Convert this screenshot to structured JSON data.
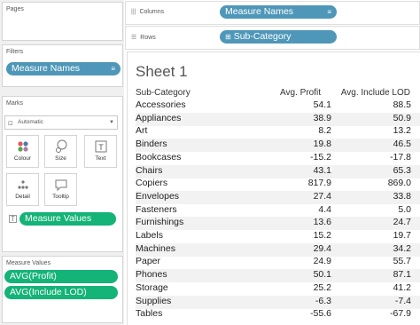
{
  "panes": {
    "pages_title": "Pages",
    "filters_title": "Filters",
    "marks_title": "Marks",
    "measure_values_title": "Measure Values"
  },
  "filters": {
    "pill": "Measure Names"
  },
  "marks": {
    "type": "Automatic",
    "buttons": {
      "colour": "Colour",
      "size": "Size",
      "text": "Text",
      "detail": "Detail",
      "tooltip": "Tooltip"
    },
    "text_pill": "Measure Values"
  },
  "measure_values": [
    "AVG(Profit)",
    "AVG(Include LOD)"
  ],
  "shelves": {
    "columns_label": "Columns",
    "columns_pill": "Measure Names",
    "rows_label": "Rows",
    "rows_pill": "Sub-Category"
  },
  "view": {
    "title": "Sheet 1",
    "headers": [
      "Sub-Category",
      "Avg. Profit",
      "Avg. Include LOD"
    ]
  },
  "chart_data": {
    "type": "table",
    "title": "Sheet 1",
    "columns": [
      "Sub-Category",
      "Avg. Profit",
      "Avg. Include LOD"
    ],
    "rows": [
      [
        "Accessories",
        "54.1",
        "88.5"
      ],
      [
        "Appliances",
        "38.9",
        "50.9"
      ],
      [
        "Art",
        "8.2",
        "13.2"
      ],
      [
        "Binders",
        "19.8",
        "46.5"
      ],
      [
        "Bookcases",
        "-15.2",
        "-17.8"
      ],
      [
        "Chairs",
        "43.1",
        "65.3"
      ],
      [
        "Copiers",
        "817.9",
        "869.0"
      ],
      [
        "Envelopes",
        "27.4",
        "33.8"
      ],
      [
        "Fasteners",
        "4.4",
        "5.0"
      ],
      [
        "Furnishings",
        "13.6",
        "24.7"
      ],
      [
        "Labels",
        "15.2",
        "19.7"
      ],
      [
        "Machines",
        "29.4",
        "34.2"
      ],
      [
        "Paper",
        "24.9",
        "55.7"
      ],
      [
        "Phones",
        "50.1",
        "87.1"
      ],
      [
        "Storage",
        "25.2",
        "41.2"
      ],
      [
        "Supplies",
        "-6.3",
        "-7.4"
      ],
      [
        "Tables",
        "-55.6",
        "-67.9"
      ]
    ]
  }
}
